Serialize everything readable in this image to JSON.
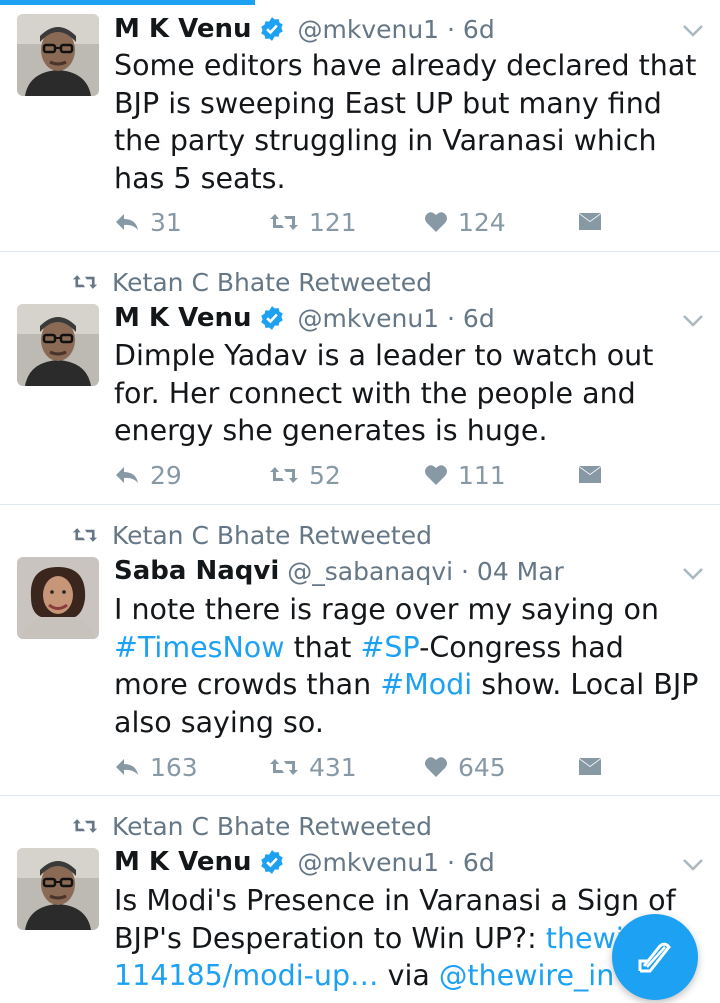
{
  "retweet_label": "Ketan C Bhate Retweeted",
  "tweets": [
    {
      "name": "M K Venu",
      "handle": "@mkvenu1 · 6d",
      "text": "Some editors have already declared that BJP is sweeping East UP but many find the party struggling in Varanasi which has 5 seats.",
      "replies": "31",
      "retweets": "121",
      "likes": "124"
    },
    {
      "name": "M K Venu",
      "handle": "@mkvenu1 · 6d",
      "text": "Dimple Yadav is a leader to watch out for. Her connect with the people and energy she generates is huge.",
      "replies": "29",
      "retweets": "52",
      "likes": "111"
    },
    {
      "name": "Saba Naqvi",
      "handle": "@_sabanaqvi · 04 Mar",
      "text_parts": [
        "I note there is rage over my saying on ",
        "#TimesNow",
        " that ",
        "#SP",
        "-Congress had more crowds than ",
        "#Modi",
        " show. Local BJP also saying so."
      ],
      "replies": "163",
      "retweets": "431",
      "likes": "645"
    },
    {
      "name": "M K Venu",
      "handle": "@mkvenu1 · 6d",
      "text_parts": [
        "Is Modi's Presence in Varanasi a Sign of BJP's Desperation to Win UP?: ",
        "thewir",
        " ",
        "114185/modi-up…",
        " via ",
        "@thewire_in"
      ]
    }
  ],
  "icons": {
    "reply": "reply-icon",
    "retweet": "retweet-icon",
    "like": "heart-icon",
    "dm": "direct-message-icon",
    "verified": "verified-badge-icon",
    "caret": "chevron-down-icon",
    "compose": "compose-tweet-icon"
  },
  "colors": {
    "accent": "#1da1f2",
    "text": "#14171a",
    "muted": "#657786",
    "action": "#8899a6"
  }
}
